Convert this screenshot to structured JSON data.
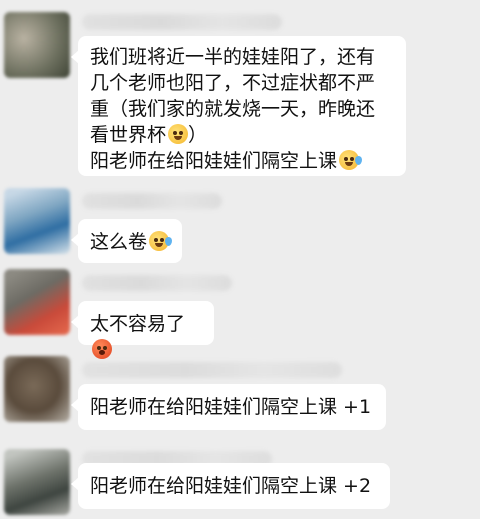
{
  "messages": [
    {
      "lines": [
        "我们班将近一半的娃娃阳了，还有",
        "几个老师也阳了，不过症状都不严",
        "重（我们家的就发烧一天，昨晚还",
        "看世界杯",
        "阳老师在给阳娃娃们隔空上课"
      ],
      "line3_suffix": "）",
      "emoji_line3": "thinking-face-icon",
      "emoji_line4": "laughing-crying-face-icon"
    },
    {
      "text": "这么卷",
      "emoji": "laughing-crying-face-icon"
    },
    {
      "text": "太不容易了",
      "emoji": "hot-face-icon"
    },
    {
      "text": "阳老师在给阳娃娃们隔空上课 +1"
    },
    {
      "text": "阳老师在给阳娃娃们隔空上课 +2"
    }
  ]
}
